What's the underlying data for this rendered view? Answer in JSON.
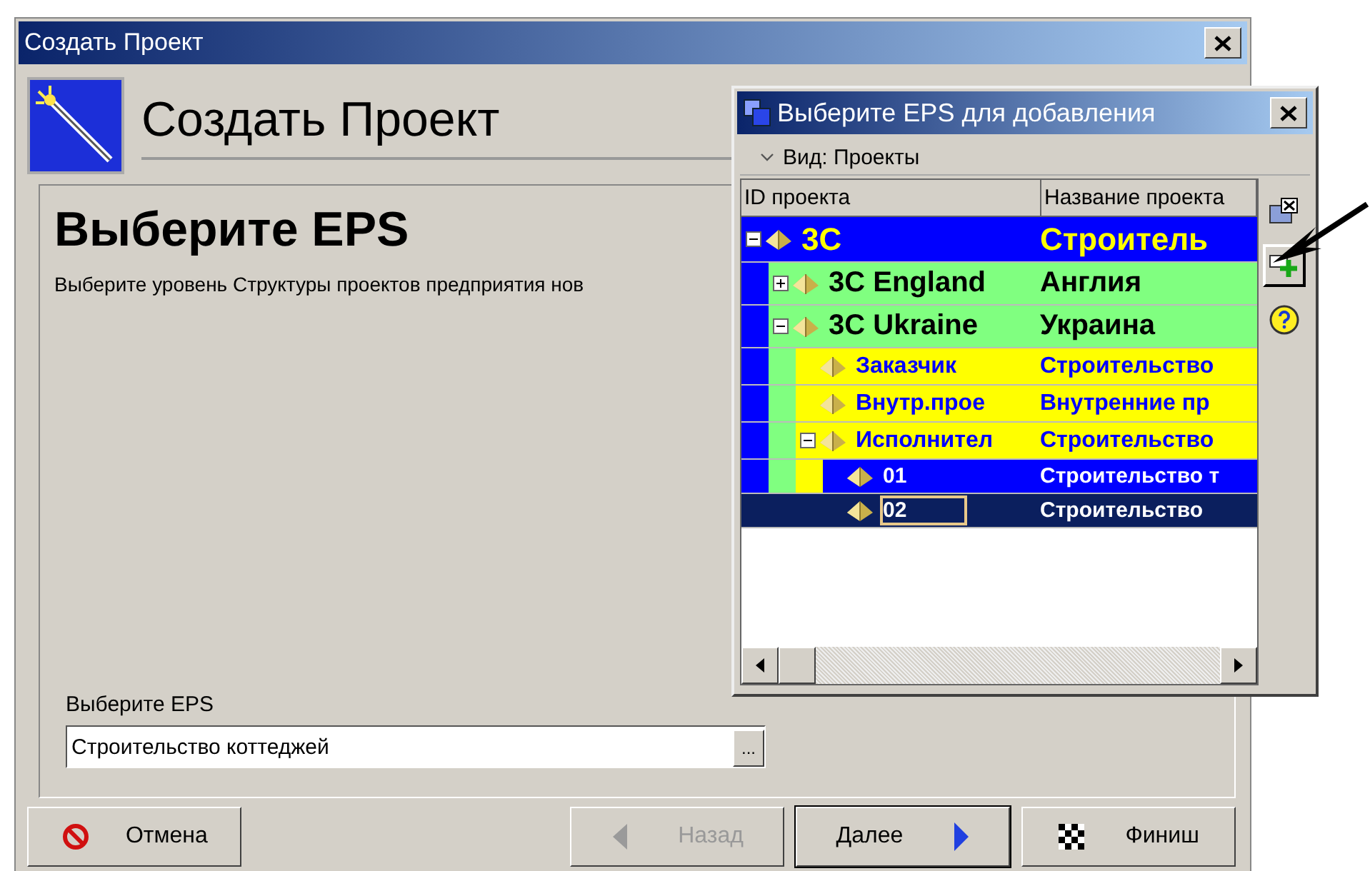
{
  "window": {
    "title": "Создать Проект"
  },
  "header": {
    "title": "Создать Проект"
  },
  "step": {
    "heading": "Выберите EPS",
    "description": "Выберите уровень Структуры проектов предприятия нов"
  },
  "eps_field": {
    "label": "Выберите EPS",
    "value": "Строительство коттеджей",
    "browse": "..."
  },
  "buttons": [
    {
      "label": "Отмена",
      "kind": "cancel",
      "disabled": false,
      "focused": false
    },
    {
      "label": "Назад",
      "kind": "back",
      "disabled": true,
      "focused": false
    },
    {
      "label": "Далее",
      "kind": "next",
      "disabled": false,
      "focused": true
    },
    {
      "label": "Финиш",
      "kind": "finish",
      "disabled": false,
      "focused": false
    }
  ],
  "popup": {
    "title": "Выберите EPS для добавления",
    "view_label": "Вид: Проекты",
    "columns": [
      "ID проекта",
      "Название проекта"
    ],
    "tree": [
      {
        "id": "3C",
        "name": "Строитель",
        "expanded": true,
        "selected": false,
        "children": [
          {
            "id": "3C England",
            "name": "Англия",
            "expanded": false,
            "selected": false
          },
          {
            "id": "3C Ukraine",
            "name": "Украина",
            "expanded": true,
            "selected": false,
            "children": [
              {
                "id": "Заказчик",
                "name": "Строительство",
                "selected": false
              },
              {
                "id": "Внутр.прое",
                "name": "Внутренние пр",
                "selected": false
              },
              {
                "id": "Исполнител",
                "name": "Строительство",
                "expanded": true,
                "selected": false,
                "children": [
                  {
                    "id": "01",
                    "name": "Строительство т",
                    "selected": false
                  },
                  {
                    "id": "02",
                    "name": "Строительство",
                    "selected": true
                  }
                ]
              }
            ]
          }
        ]
      }
    ]
  }
}
